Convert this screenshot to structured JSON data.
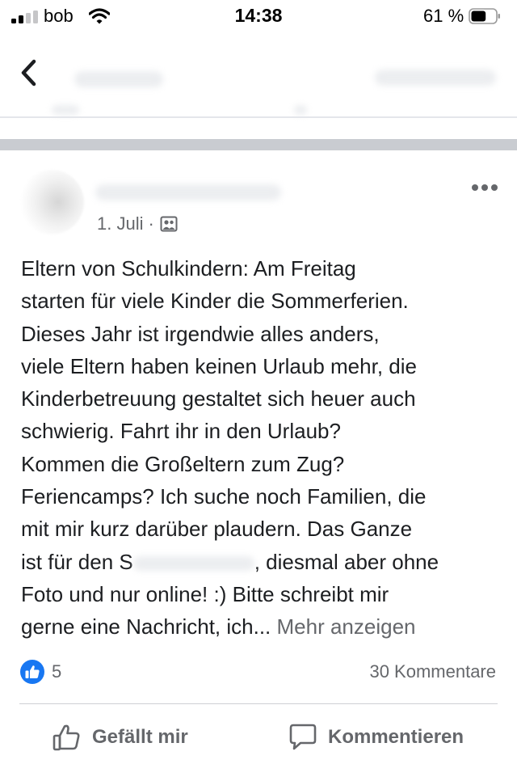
{
  "status_bar": {
    "carrier": "bob",
    "time": "14:38",
    "battery_percent": "61 %",
    "battery_level": 0.61,
    "signal_bars_active": 2,
    "signal_bars_total": 4
  },
  "nav": {
    "back_icon": "chevron-left-icon"
  },
  "post": {
    "date": "1. Juli",
    "separator": "·",
    "audience_icon": "group-icon",
    "more_icon": "ellipsis-icon",
    "text": "Eltern von Schulkindern: Am Freitag\nstarten für viele Kinder die Sommerferien.\nDieses Jahr ist irgendwie alles anders,\nviele Eltern haben keinen Urlaub mehr, die\nKinderbetreuung gestaltet sich heuer auch\nschwierig. Fahrt ihr in den Urlaub?\nKommen die Großeltern zum Zug?\nFeriencamps? Ich suche noch Familien, die\nmit mir kurz darüber plaudern. Das Ganze\nist für den S",
    "text_after_redaction": ", diesmal aber ohne\nFoto und nur online! :) Bitte schreibt mir\ngerne eine Nachricht, ich...",
    "see_more": "Mehr anzeigen"
  },
  "reactions": {
    "like_count": "5",
    "comments": "30 Kommentare"
  },
  "actions": {
    "like_label": "Gefällt mir",
    "comment_label": "Kommentieren"
  },
  "colors": {
    "accent": "#1877f2",
    "secondary_text": "#65676b",
    "separator": "#c9ccd1"
  }
}
